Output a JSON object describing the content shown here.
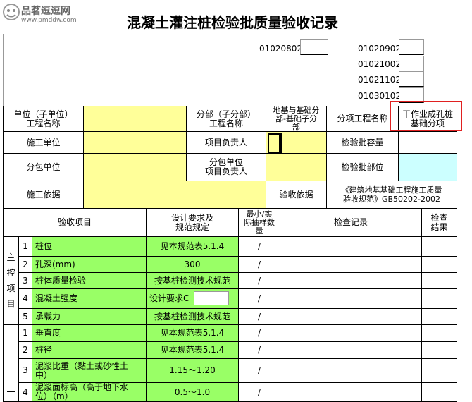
{
  "watermark": {
    "site_name": "品茗逗逗网",
    "site_url": "www.pmddw.com"
  },
  "title": "混凝土灌注桩检验批质量验收记录",
  "codes": {
    "left": [
      "01020802"
    ],
    "right": [
      "01020902",
      "01021002",
      "01021102",
      "01030102"
    ]
  },
  "header": {
    "unit_label": "单位（子单位）\n工程名称",
    "part_label": "分部（子分部）\n工程名称",
    "part_value": "地基与基础分\n部-基础子分\n部",
    "sub_item_label": "分项工程名称",
    "sub_item_value": "干作业成孔桩\n基础分项",
    "construction_unit_label": "施工单位",
    "project_manager_label": "项目负责人",
    "batch_capacity_label": "检验批容量",
    "subcontract_unit_label": "分包单位",
    "subcontract_manager_label": "分包单位\n项目负责人",
    "batch_location_label": "检验批部位",
    "basis_label": "施工依据",
    "acceptance_basis_label": "验收依据",
    "acceptance_basis_value": "《建筑地基基础工程施工质量\n验收规范》GB50202-2002"
  },
  "columns": {
    "item": "验收项目",
    "design": "设计要求及\n规范规定",
    "sample": "最小/实\n际抽样数\n量",
    "record": "检查记录",
    "result": "检查\n结果"
  },
  "main_group_label": "主\n控\n项\n目",
  "general_group_label": "一",
  "main_items": [
    {
      "no": "1",
      "name": "桩位",
      "design": "见本规范表5.1.4",
      "sample": "/"
    },
    {
      "no": "2",
      "name": "孔深(mm)",
      "design": "300",
      "sample": "/"
    },
    {
      "no": "3",
      "name": "桩体质量检验",
      "design": "按基桩检测技术规范",
      "sample": "/"
    },
    {
      "no": "4",
      "name": "混凝土强度",
      "design": "设计要求C",
      "sample": "/"
    },
    {
      "no": "5",
      "name": "承载力",
      "design": "按基桩检测技术规范",
      "sample": "/"
    }
  ],
  "general_items": [
    {
      "no": "1",
      "name": "垂直度",
      "design": "见本规范表5.1.4",
      "sample": "/"
    },
    {
      "no": "2",
      "name": "桩径",
      "design": "见本规范表5.1.4",
      "sample": "/"
    },
    {
      "no": "3",
      "name": "泥浆比重（黏土或砂性土\n中）",
      "design": "1.15～1.20",
      "sample": "/"
    },
    {
      "no": "4",
      "name": "泥浆面标高（高于地下水\n位）（m）",
      "design": "0.5～1.0",
      "sample": "/"
    }
  ]
}
